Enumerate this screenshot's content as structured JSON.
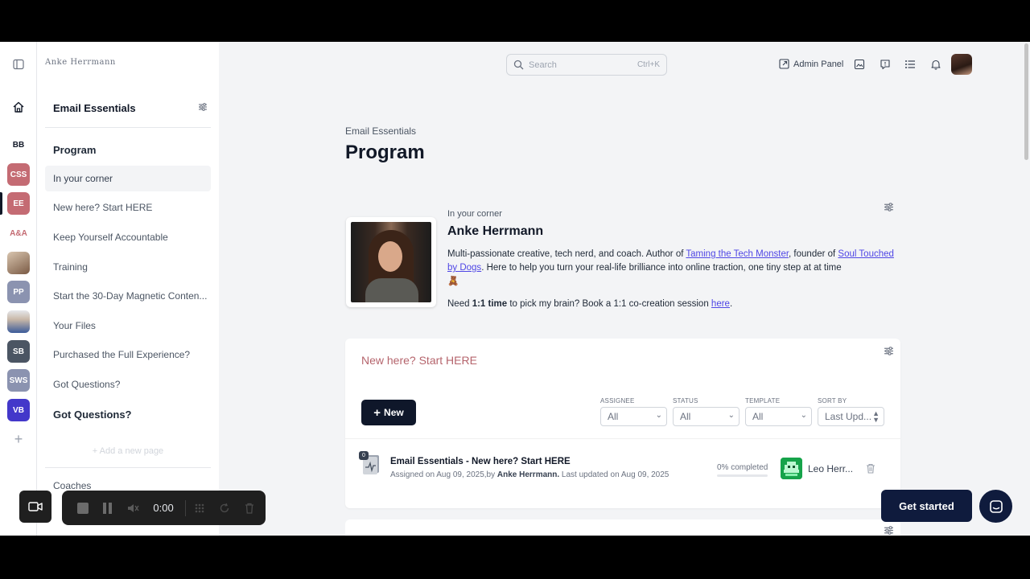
{
  "app": {
    "logo_text": "Anke Herrmann"
  },
  "rail": {
    "items": [
      {
        "label": "",
        "icon": "home-icon",
        "color": ""
      },
      {
        "label": "BB",
        "color": "#ffffff"
      },
      {
        "label": "CSS",
        "color": "#c46b73"
      },
      {
        "label": "EE",
        "color": "#c46b73"
      },
      {
        "label": "A&A",
        "color": "#ffffff"
      },
      {
        "label": "",
        "icon": "avatar-photo",
        "color": ""
      },
      {
        "label": "PP",
        "color": "#8b93b0"
      },
      {
        "label": "",
        "icon": "avatar-photo",
        "color": ""
      },
      {
        "label": "SB",
        "color": "#4b5563"
      },
      {
        "label": "SWS",
        "color": "#8b93b0"
      },
      {
        "label": "VB",
        "color": "#4338ca"
      }
    ]
  },
  "sidebar": {
    "title": "Email Essentials",
    "items": [
      {
        "label": "Program",
        "type": "head"
      },
      {
        "label": "In your corner",
        "type": "active"
      },
      {
        "label": "New here? Start HERE",
        "type": "item"
      },
      {
        "label": "Keep Yourself Accountable",
        "type": "item"
      },
      {
        "label": "Training",
        "type": "item"
      },
      {
        "label": "Start the 30-Day Magnetic Conten...",
        "type": "item"
      },
      {
        "label": "Your Files",
        "type": "item"
      },
      {
        "label": "Purchased the Full Experience?",
        "type": "item"
      },
      {
        "label": "Got Questions?",
        "type": "item"
      },
      {
        "label": "Got Questions?",
        "type": "head"
      }
    ],
    "add_page": "+ Add a new page",
    "coaches": "Coaches"
  },
  "topbar": {
    "search_placeholder": "Search",
    "search_shortcut": "Ctrl+K",
    "admin_panel": "Admin Panel"
  },
  "page": {
    "breadcrumb": "Email Essentials",
    "title": "Program"
  },
  "profile": {
    "subtitle": "In your corner",
    "name": "Anke Herrmann",
    "bio_1": "Multi-passionate creative, tech nerd, and coach. Author of ",
    "bio_link_1": "Taming the Tech Monster",
    "bio_2": ", founder of ",
    "bio_link_2": "Soul Touched by Dogs",
    "bio_3": ". Here to help you turn your real-life brilliance into online traction, one tiny step at at time",
    "bio_emoji": "🧸",
    "need_1": "Need ",
    "need_bold": "1:1 time",
    "need_2": " to pick my brain? Book a 1:1 co-creation session ",
    "need_link": "here",
    "need_3": "."
  },
  "card": {
    "title": "New here? Start HERE",
    "new_button": "New",
    "filters": [
      {
        "label": "ASSIGNEE",
        "value": "All"
      },
      {
        "label": "STATUS",
        "value": "All"
      },
      {
        "label": "TEMPLATE",
        "value": "All"
      },
      {
        "label": "SORT BY",
        "value": "Last Upd..."
      }
    ],
    "row": {
      "badge": "0",
      "title": "Email Essentials - New here? Start HERE",
      "meta_1": "Assigned on Aug 09, 2025,by ",
      "meta_bold": "Anke Herrmann.",
      "meta_2": " Last updated on Aug 09, 2025",
      "progress_text": "0% completed",
      "progress": 0,
      "assignee": "Leo Herr..."
    }
  },
  "floating": {
    "get_started": "Get started"
  },
  "recorder": {
    "time": "0:00"
  },
  "colors": {
    "accent_dark": "#0f172a",
    "card_title": "#b5646c",
    "link": "#4f46e5"
  }
}
